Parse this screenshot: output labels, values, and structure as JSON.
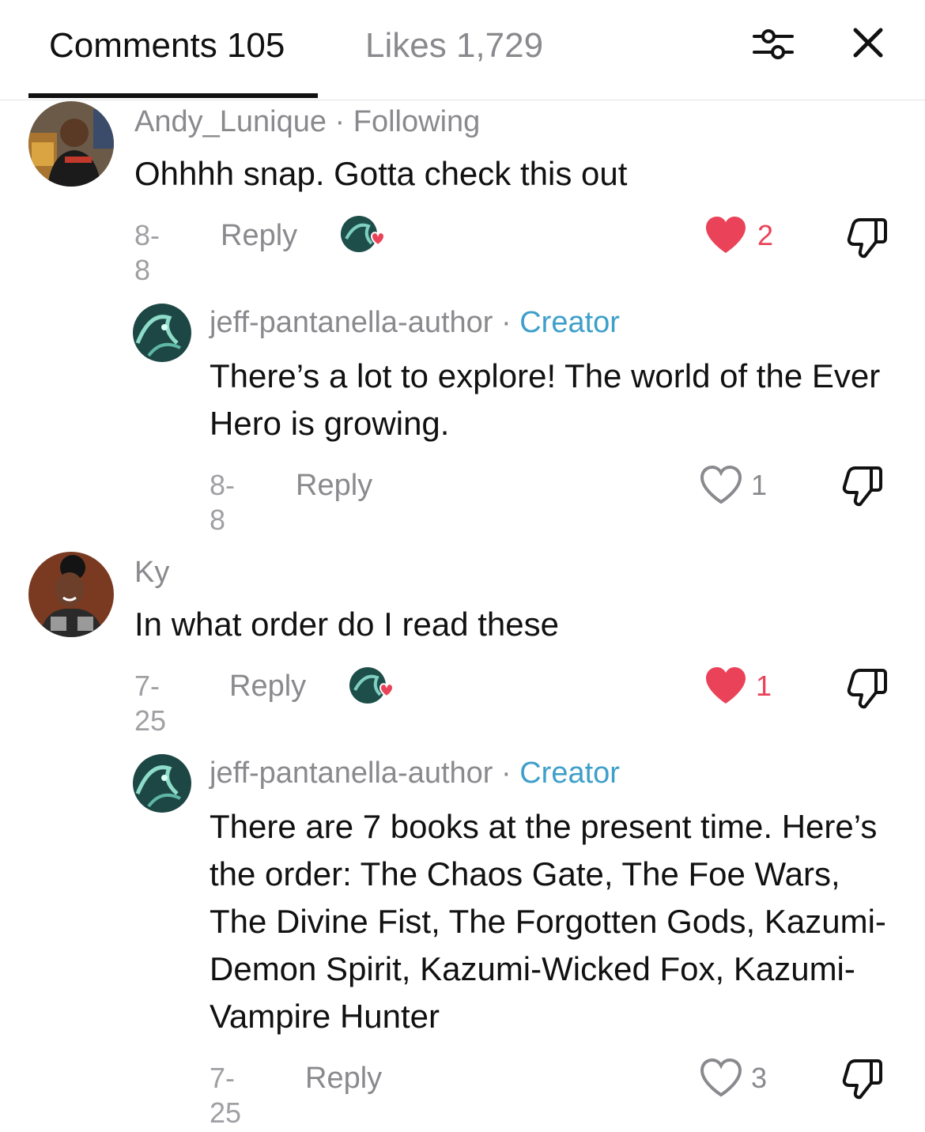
{
  "header": {
    "comments_tab": "Comments 105",
    "likes_tab": "Likes 1,729"
  },
  "colors": {
    "accent_blue": "#3e9fca",
    "like_red": "#ea4359",
    "muted": "#8a8a8e"
  },
  "comments": [
    {
      "username": "Andy_Lunique",
      "relation": " · Following",
      "text": "Ohhhh snap. Gotta check this out",
      "date": "8-8",
      "reply_label": "Reply",
      "like_count": "2",
      "liked": true,
      "creator_liked": true
    },
    {
      "username": "jeff-pantanella-author",
      "relation": " · ",
      "badge": "Creator",
      "text": "There’s a lot to explore! The world of the Ever Hero is growing.",
      "date": "8-8",
      "reply_label": "Reply",
      "like_count": "1",
      "liked": false
    },
    {
      "username": "Ky",
      "text": "In what order do I read these",
      "date": "7-25",
      "reply_label": "Reply",
      "like_count": "1",
      "liked": true,
      "creator_liked": true
    },
    {
      "username": "jeff-pantanella-author",
      "relation": " · ",
      "badge": "Creator",
      "text": "There are 7 books at the present time. Here’s the order: The Chaos Gate, The Foe Wars, The Divine Fist, The Forgotten Gods, Kazumi-Demon Spirit, Kazumi-Wicked Fox, Kazumi-Vampire Hunter",
      "date": "7-25",
      "reply_label": "Reply",
      "like_count": "3",
      "liked": false
    }
  ]
}
